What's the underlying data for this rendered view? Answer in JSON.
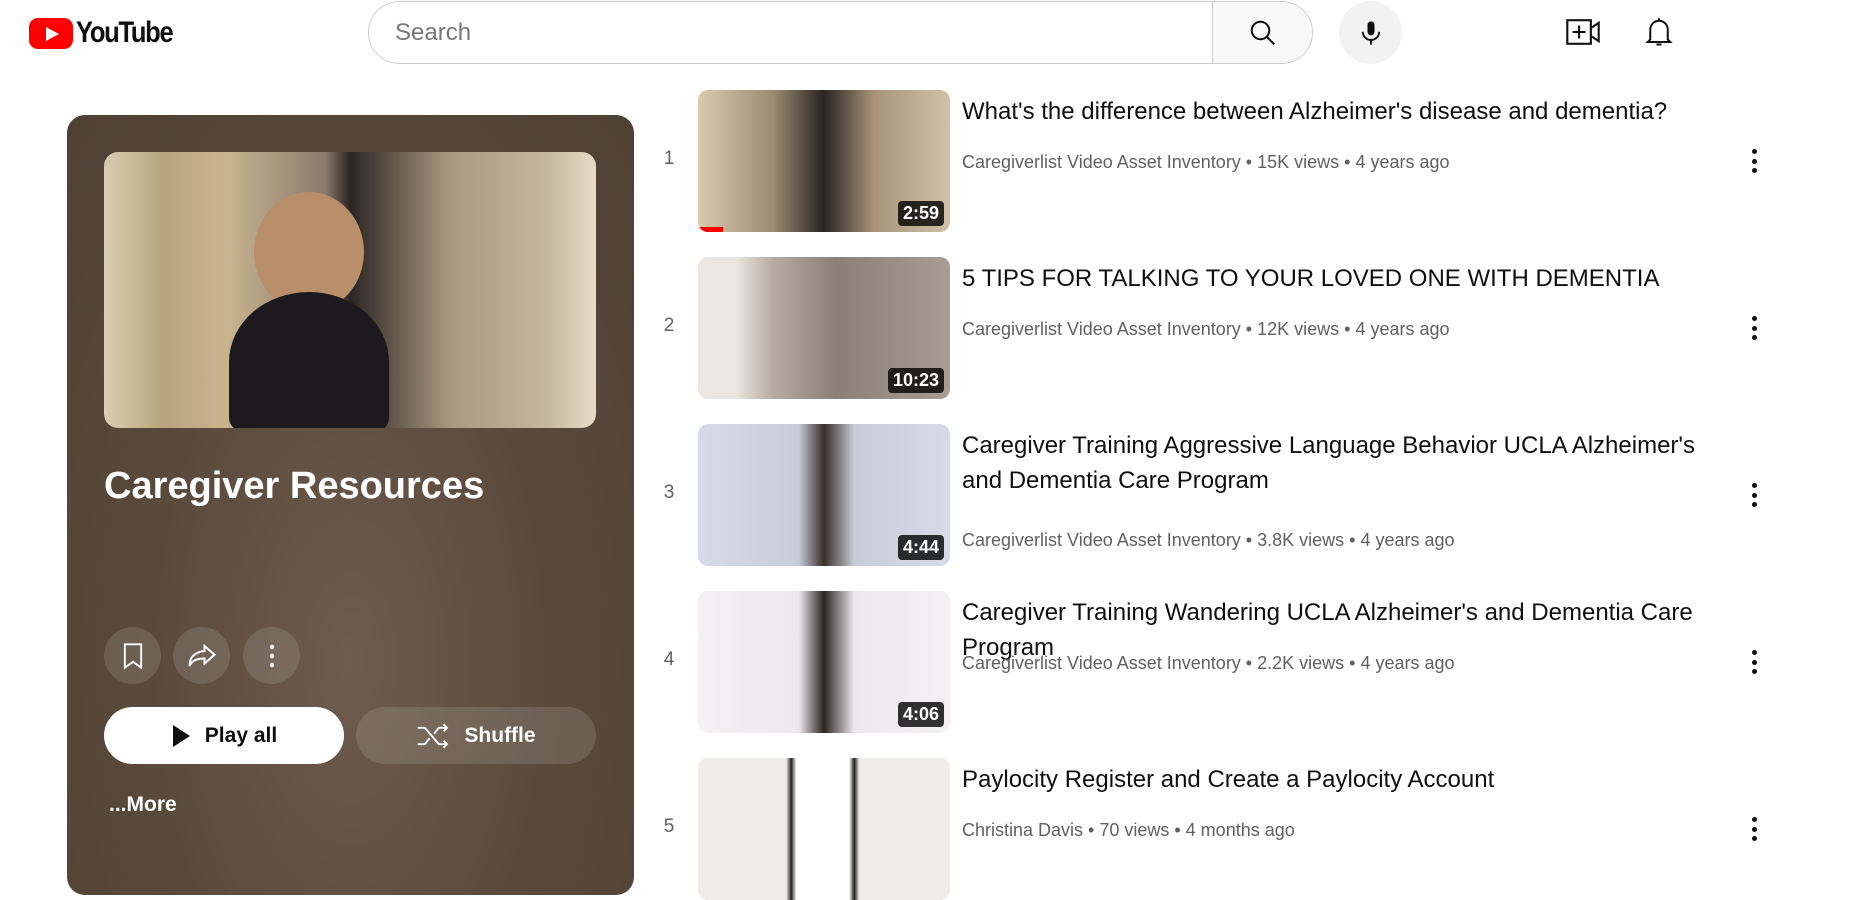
{
  "header": {
    "logo": "YouTube",
    "search_placeholder": "Search"
  },
  "colors": {
    "brand": "#ff0000",
    "panel": "#5a4a3c"
  },
  "playlist": {
    "title": "Caregiver Resources",
    "play_all": "Play all",
    "shuffle": "Shuffle",
    "more": "...More"
  },
  "videos": [
    {
      "index": "1",
      "title": "What's the difference between Alzheimer's disease and dementia?",
      "meta": "Caregiverlist Video Asset Inventory • 15K views • 4 years ago",
      "duration": "2:59",
      "watched_fraction": 0.1
    },
    {
      "index": "2",
      "title": "5 TIPS FOR TALKING TO YOUR LOVED ONE WITH DEMENTIA",
      "meta": "Caregiverlist Video Asset Inventory • 12K views • 4 years ago",
      "duration": "10:23"
    },
    {
      "index": "3",
      "title": "Caregiver Training Aggressive Language Behavior UCLA Alzheimer's and Dementia Care Program",
      "meta": "Caregiverlist Video Asset Inventory • 3.8K views • 4 years ago",
      "duration": "4:44"
    },
    {
      "index": "4",
      "title": "Caregiver Training Wandering UCLA Alzheimer's and Dementia Care Program",
      "meta": "Caregiverlist Video Asset Inventory • 2.2K views • 4 years ago",
      "duration": "4:06"
    },
    {
      "index": "5",
      "title": "Paylocity Register and Create a Paylocity Account",
      "meta": "Christina Davis • 70 views • 4 months ago",
      "duration": ""
    }
  ]
}
